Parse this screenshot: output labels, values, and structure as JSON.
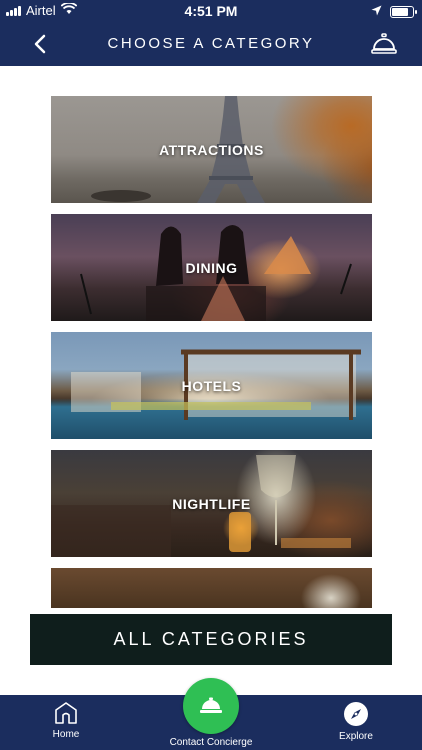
{
  "status_bar": {
    "carrier": "Airtel",
    "time": "4:51 PM",
    "icons": [
      "signal-icon",
      "wifi-icon",
      "location-arrow-icon",
      "battery-icon"
    ]
  },
  "header": {
    "title": "CHOOSE A CATEGORY",
    "back_icon": "chevron-left-icon",
    "concierge_icon": "service-bell-icon"
  },
  "categories": [
    {
      "label": "ATTRACTIONS"
    },
    {
      "label": "DINING"
    },
    {
      "label": "HOTELS"
    },
    {
      "label": "NIGHTLIFE"
    },
    {
      "label": ""
    }
  ],
  "all_categories_label": "ALL CATEGORIES",
  "tab_bar": {
    "home_label": "Home",
    "concierge_label": "Contact Concierge",
    "explore_label": "Explore"
  },
  "colors": {
    "brand_navy": "#1b2d5e",
    "concierge_green": "#2fbf54",
    "button_dark": "#0f1e1c"
  }
}
